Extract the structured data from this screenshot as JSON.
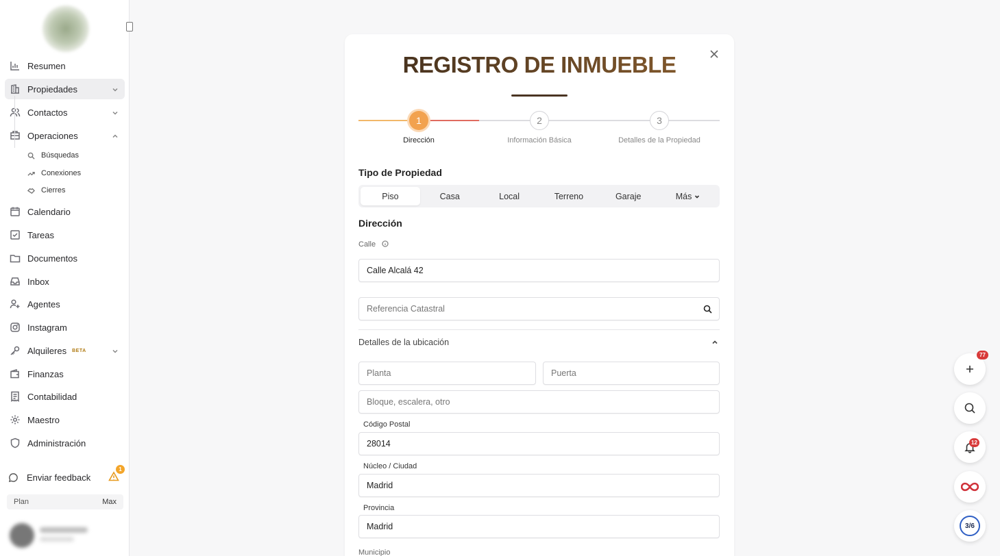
{
  "sidebar": {
    "items": [
      {
        "label": "Resumen",
        "icon": "chart-icon"
      },
      {
        "label": "Propiedades",
        "icon": "building-icon"
      },
      {
        "label": "Contactos",
        "icon": "users-icon"
      },
      {
        "label": "Operaciones",
        "icon": "handshake-icon"
      },
      {
        "label": "Calendario",
        "icon": "calendar-icon"
      },
      {
        "label": "Tareas",
        "icon": "checkbox-icon"
      },
      {
        "label": "Documentos",
        "icon": "folder-icon"
      },
      {
        "label": "Inbox",
        "icon": "inbox-icon"
      },
      {
        "label": "Agentes",
        "icon": "user-plus-icon"
      },
      {
        "label": "Instagram",
        "icon": "instagram-icon"
      },
      {
        "label": "Alquileres",
        "icon": "key-icon",
        "badge": "BETA"
      },
      {
        "label": "Finanzas",
        "icon": "wallet-icon"
      },
      {
        "label": "Contabilidad",
        "icon": "receipt-icon"
      },
      {
        "label": "Maestro",
        "icon": "gear-icon"
      },
      {
        "label": "Administración",
        "icon": "shield-icon"
      }
    ],
    "sub_items": [
      {
        "label": "Búsquedas",
        "icon": "search-icon"
      },
      {
        "label": "Conexiones",
        "icon": "trend-icon"
      },
      {
        "label": "Cierres",
        "icon": "handshake-icon"
      }
    ],
    "feedback": {
      "label": "Enviar feedback",
      "badge": "1"
    },
    "plan": {
      "label": "Plan",
      "value": "Max"
    }
  },
  "modal": {
    "title": "REGISTRO DE INMUEBLE",
    "steps": [
      {
        "number": "1",
        "label": "Dirección"
      },
      {
        "number": "2",
        "label": "Información Básica"
      },
      {
        "number": "3",
        "label": "Detalles de la Propiedad"
      }
    ],
    "property_type": {
      "heading": "Tipo de Propiedad",
      "tabs": [
        "Piso",
        "Casa",
        "Local",
        "Terreno",
        "Garaje",
        "Más"
      ],
      "selected": "Piso"
    },
    "address": {
      "heading": "Dirección",
      "street_label": "Calle",
      "street_value": "Calle Alcalá 42",
      "cadastral_placeholder": "Referencia Catastral",
      "location_details": "Detalles de la ubicación",
      "floor_placeholder": "Planta",
      "door_placeholder": "Puerta",
      "block_placeholder": "Bloque, escalera, otro",
      "postal_label": "Código Postal",
      "postal_value": "28014",
      "city_label": "Núcleo / Ciudad",
      "city_value": "Madrid",
      "province_label": "Provincia",
      "province_value": "Madrid",
      "municipality_label": "Municipio"
    }
  },
  "fabs": {
    "add_badge": "77",
    "notif_badge": "12",
    "progress": "3/6"
  },
  "colors": {
    "accent": "#f2a24f",
    "title_brown": "#6b4a29",
    "badge_red": "#d83a3a"
  }
}
